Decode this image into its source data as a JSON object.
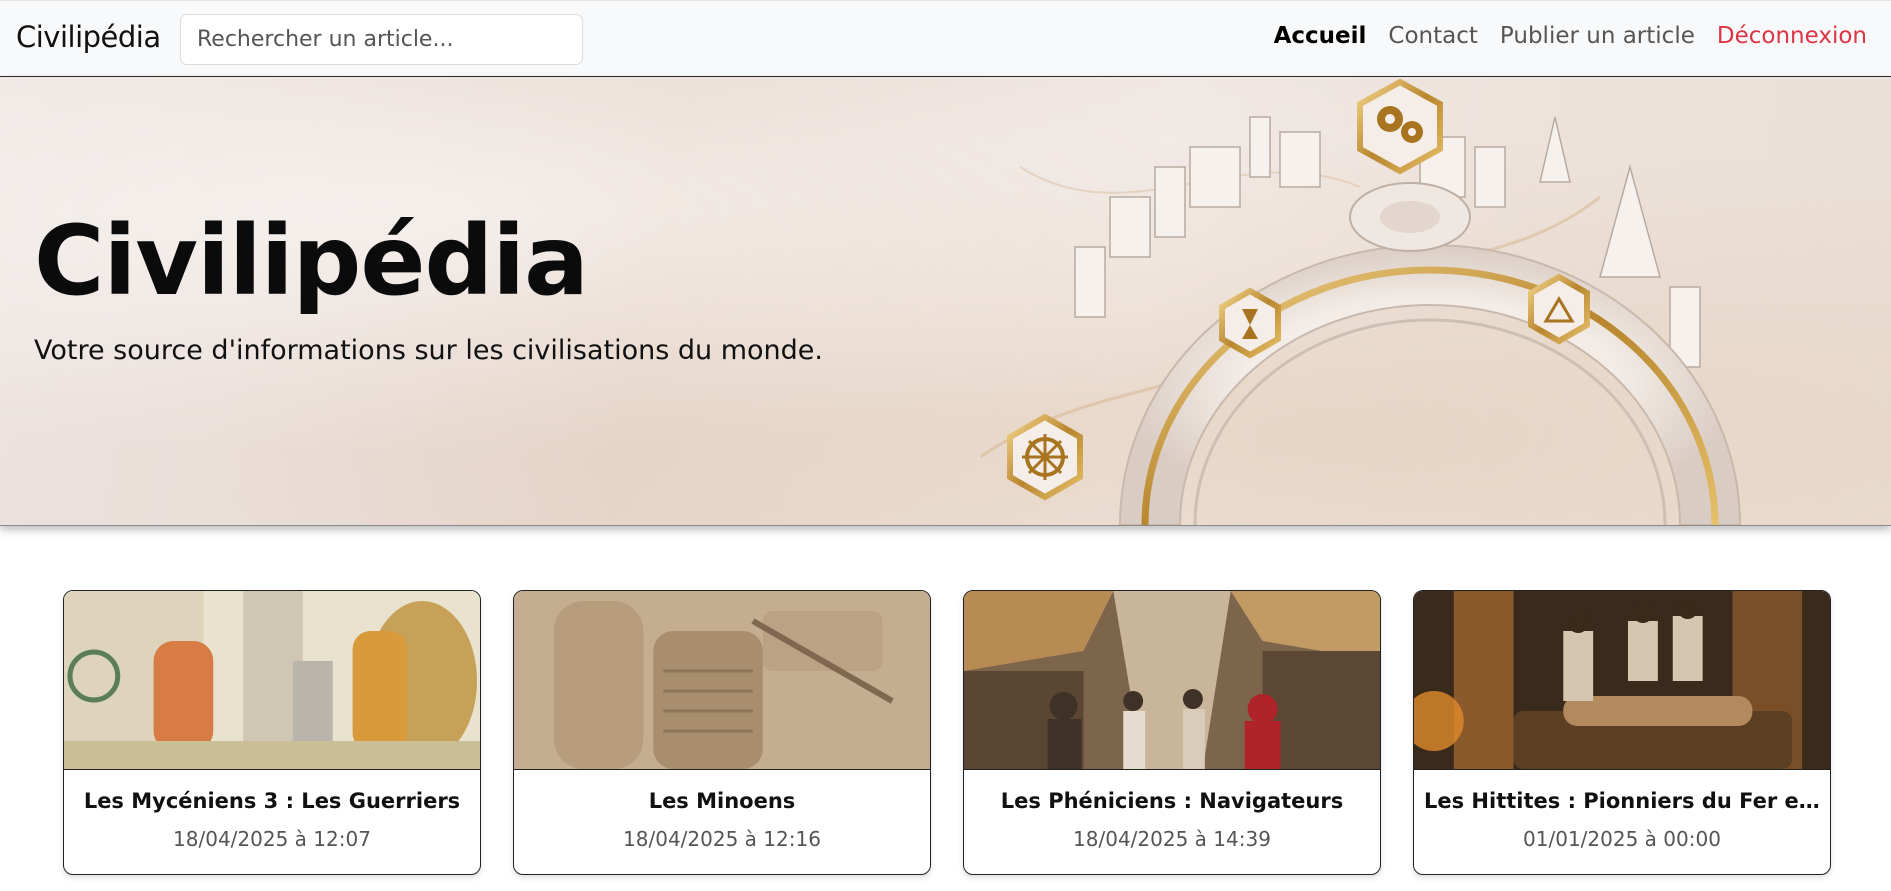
{
  "navbar": {
    "brand": "Civilipédia",
    "search_placeholder": "Rechercher un article...",
    "links": [
      {
        "label": "Accueil",
        "state": "active"
      },
      {
        "label": "Contact",
        "state": "default"
      },
      {
        "label": "Publier un article",
        "state": "default"
      },
      {
        "label": "Déconnexion",
        "state": "danger"
      }
    ]
  },
  "hero": {
    "title": "Civilipédia",
    "subtitle": "Votre source d'informations sur les civilisations du monde.",
    "image_icon": "civilizations-arch-illustration"
  },
  "articles": [
    {
      "title": "Les Mycéniens 3 : Les Guerriers",
      "date": "18/04/2025 à 12:07",
      "image_icon": "warriors-illustration"
    },
    {
      "title": "Les Minoens",
      "date": "18/04/2025 à 12:16",
      "image_icon": "stone-relief-illustration"
    },
    {
      "title": "Les Phéniciens : Navigateurs",
      "date": "18/04/2025 à 14:39",
      "image_icon": "market-street-illustration"
    },
    {
      "title": "Les Hittites : Pionniers du Fer et Di...",
      "date": "01/01/2025 à 00:00",
      "image_icon": "mummification-illustration"
    }
  ],
  "colors": {
    "danger": "#dc3545",
    "navbar_bg": "#f8f9fa",
    "gold": "#b8862e"
  }
}
